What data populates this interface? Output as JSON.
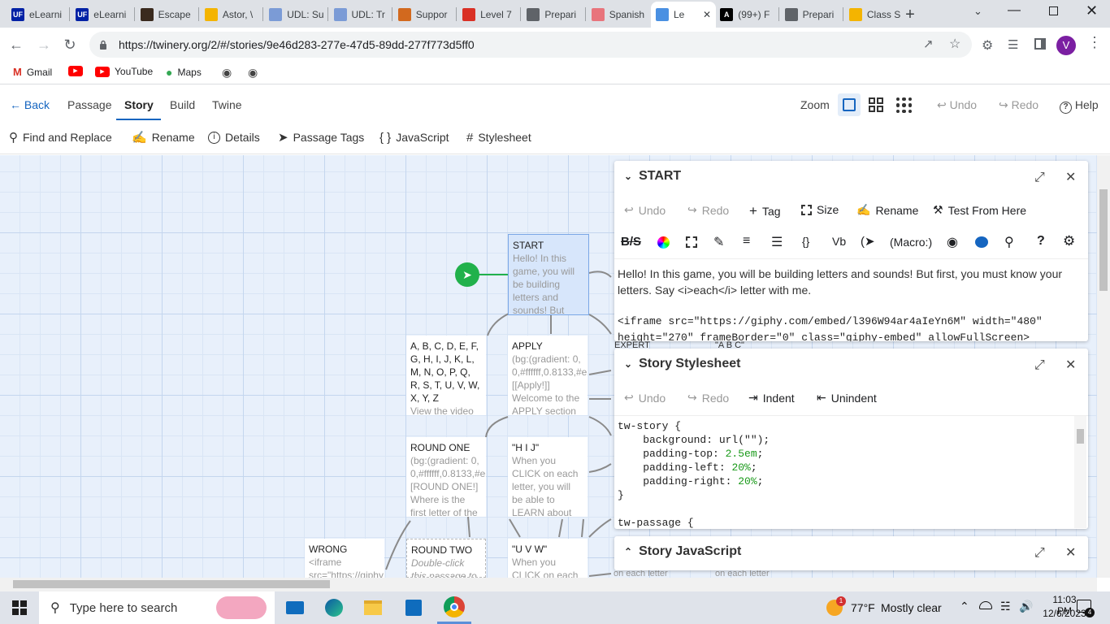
{
  "browser": {
    "tabs": [
      {
        "label": "eLearni",
        "color": "#0021a5",
        "glyph": "UF"
      },
      {
        "label": "eLearni",
        "color": "#0021a5",
        "glyph": "UF"
      },
      {
        "label": "Escape",
        "color": "#3a2a1e",
        "glyph": ""
      },
      {
        "label": "Astor, \\",
        "color": "#f4b400",
        "glyph": ""
      },
      {
        "label": "UDL: Su",
        "color": "#7b9bd6",
        "glyph": ""
      },
      {
        "label": "UDL: Tr",
        "color": "#7b9bd6",
        "glyph": ""
      },
      {
        "label": "Suppor",
        "color": "#d2691e",
        "glyph": ""
      },
      {
        "label": "Level 7",
        "color": "#d93025",
        "glyph": ""
      },
      {
        "label": "Prepari",
        "color": "#5f6368",
        "glyph": ""
      },
      {
        "label": "Spanish",
        "color": "#e8747c",
        "glyph": ""
      },
      {
        "label": "Le",
        "color": "#4a90e2",
        "glyph": ""
      },
      {
        "label": "(99+) F",
        "color": "#000000",
        "glyph": "A"
      },
      {
        "label": "Prepari",
        "color": "#5f6368",
        "glyph": ""
      },
      {
        "label": "Class S",
        "color": "#f4b400",
        "glyph": ""
      }
    ],
    "url": "https://twinery.org/2/#/stories/9e46d283-277e-47d5-89dd-277f773d5ff0",
    "profile": "V",
    "bookmarks": [
      "Gmail",
      "",
      "YouTube",
      "Maps",
      "",
      ""
    ]
  },
  "twine": {
    "nav": {
      "back": "Back",
      "passage": "Passage",
      "story": "Story",
      "build": "Build",
      "twine": "Twine"
    },
    "right": {
      "zoom": "Zoom",
      "undo": "Undo",
      "redo": "Redo",
      "help": "Help"
    },
    "tools": {
      "find": "Find and Replace",
      "rename": "Rename",
      "details": "Details",
      "tags": "Passage Tags",
      "js": "JavaScript",
      "css": "Stylesheet"
    }
  },
  "cards": [
    {
      "title": "START",
      "excerpt": "Hello! In this game, you will be building letters and sounds! But first,"
    },
    {
      "title": "",
      "excerpt": "A, B, C, D, E, F, G, H, I, J, K, L, M, N, O, P, Q, R, S, T, U, V, W, X, Y, Z",
      "sub": "View the video"
    },
    {
      "title": "APPLY",
      "excerpt": "(bg:(gradient: 0, 0,#ffffff,0.8133,#e [[Apply!]] Welcome to the APPLY section of"
    },
    {
      "title": "ROUND ONE",
      "excerpt": "(bg:(gradient: 0, 0,#ffffff,0.8133,#e [ROUND ONE!] Where is the first letter of the"
    },
    {
      "title": "\"H I J\"",
      "excerpt": "When you CLICK on each letter, you will be able to LEARN about the letter name"
    },
    {
      "title": "WRONG",
      "excerpt": "<iframe src=\"https://giphy"
    },
    {
      "title": "ROUND TWO",
      "excerpt": "Double-click this passage to edit"
    },
    {
      "title": "\"U V W\"",
      "excerpt": "When you CLICK on each letter"
    },
    {
      "title": "EXPERT",
      "excerpt": ""
    },
    {
      "title": "\"A B C\"",
      "excerpt": ""
    },
    {
      "title": "",
      "excerpt": "on each letter"
    },
    {
      "title": "",
      "excerpt": "on each letter"
    }
  ],
  "passage_panel": {
    "title": "START",
    "undo": "Undo",
    "redo": "Redo",
    "tag": "Tag",
    "size": "Size",
    "rename": "Rename",
    "test": "Test From Here",
    "macro": "(Macro:)",
    "text1": "Hello! In this game, you will be building letters and sounds! But first, you must know your",
    "text2": "letters. Say <i>each</i> letter with me.",
    "text3": "<iframe src=\"https://giphy.com/embed/l396W94ar4aIeYn6M\" width=\"480\"",
    "text4": "height=\"270\" frameBorder=\"0\" class=\"giphy-embed\" allowFullScreen>"
  },
  "stylesheet_panel": {
    "title": "Story Stylesheet",
    "undo": "Undo",
    "redo": "Redo",
    "indent": "Indent",
    "unindent": "Unindent",
    "lines": [
      "tw-story {",
      "    background: url(\"\");",
      "    padding-top: 2.5em;",
      "    padding-left: 20%;",
      "    padding-right: 20%;",
      "}",
      "",
      "tw-passage {"
    ]
  },
  "js_panel": {
    "title": "Story JavaScript"
  },
  "taskbar": {
    "search": "Type here to search",
    "temp": "77°F",
    "weather": "Mostly clear",
    "time": "11:03 PM",
    "date": "12/6/2023",
    "badge": "1",
    "notif": "4"
  }
}
